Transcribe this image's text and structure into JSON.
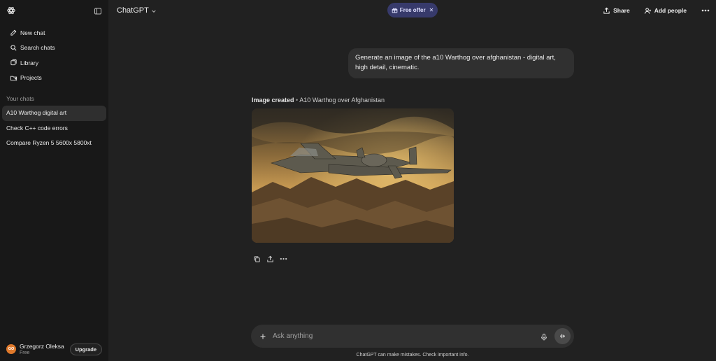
{
  "sidebar": {
    "menu": [
      {
        "label": "New chat",
        "icon": "new-chat-icon"
      },
      {
        "label": "Search chats",
        "icon": "search-icon"
      },
      {
        "label": "Library",
        "icon": "library-icon"
      },
      {
        "label": "Projects",
        "icon": "projects-icon"
      }
    ],
    "section_label": "Your chats",
    "chats": [
      {
        "label": "A10 Warthog digital art",
        "active": true
      },
      {
        "label": "Check C++ code errors",
        "active": false
      },
      {
        "label": "Compare Ryzen 5 5600x 5800xt",
        "active": false
      }
    ],
    "user": {
      "initials": "GO",
      "name": "Grzegorz Oleksa",
      "plan": "Free",
      "upgrade_label": "Upgrade"
    }
  },
  "header": {
    "model": "ChatGPT",
    "free_offer": "Free offer",
    "share": "Share",
    "add_people": "Add people"
  },
  "conversation": {
    "user_message": "Generate an image of the a10 Warthog over afghanistan - digital art, high detail, cinematic.",
    "image_status": "Image created",
    "image_separator": "•",
    "image_title": "A10 Warthog over Afghanistan"
  },
  "composer": {
    "placeholder": "Ask anything",
    "disclaimer": "ChatGPT can make mistakes. Check important info."
  },
  "colors": {
    "sidebar_bg": "#181818",
    "main_bg": "#212121",
    "bubble_bg": "#303030",
    "offer_bg": "#373a6b",
    "avatar_bg": "#e07a2c"
  }
}
